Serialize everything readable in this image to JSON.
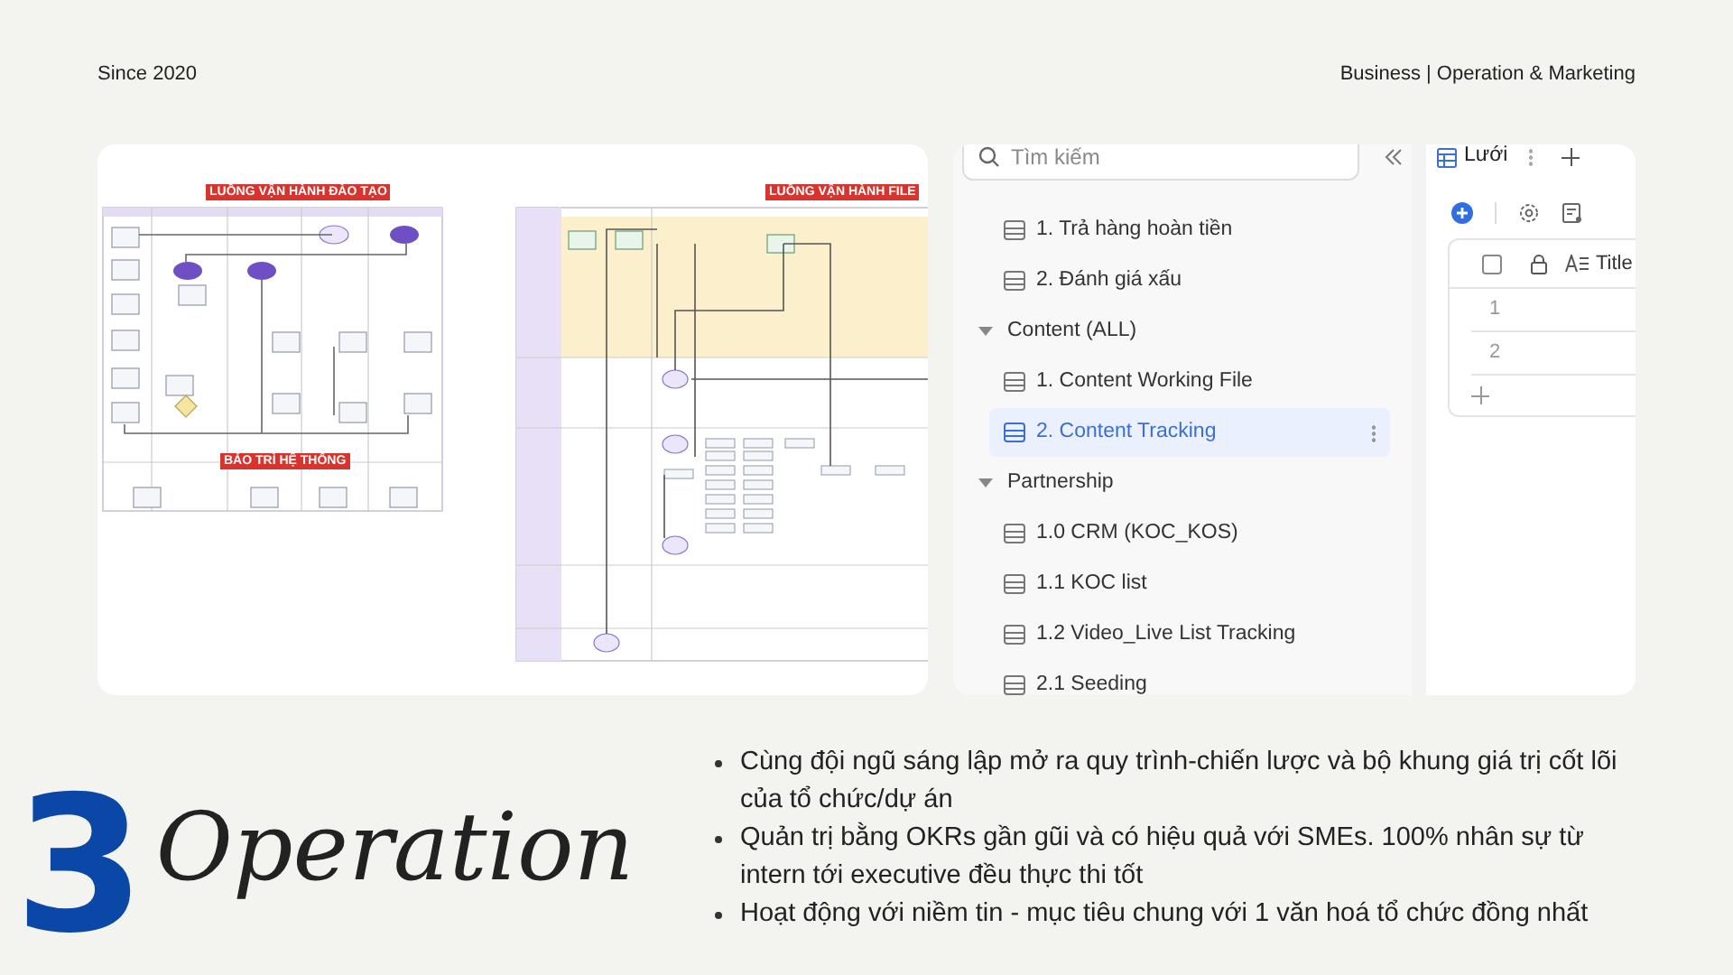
{
  "header": {
    "left": "Since 2020",
    "right": "Business | Operation & Marketing"
  },
  "diagrams": [
    {
      "title": "LUỒNG VẬN HÀNH ĐÀO TẠO",
      "subtitle": "BẢO TRÌ HỆ THỐNG"
    },
    {
      "title": "LUỒNG VẬN HÀNH FILE"
    }
  ],
  "app": {
    "search": {
      "placeholder": "Tìm kiếm"
    },
    "tree": [
      {
        "kind": "table",
        "label": "1. Trả hàng hoàn tiền",
        "selected": false
      },
      {
        "kind": "table",
        "label": "2. Đánh giá xấu",
        "selected": false
      },
      {
        "kind": "folder",
        "label": "Content (ALL)",
        "expanded": true,
        "children": [
          {
            "kind": "table",
            "label": "1. Content Working File",
            "selected": false
          },
          {
            "kind": "table",
            "label": "2. Content Tracking",
            "selected": true
          }
        ]
      },
      {
        "kind": "folder",
        "label": "Partnership",
        "expanded": true,
        "children": [
          {
            "kind": "table",
            "label": "1.0 CRM (KOC_KOS)",
            "selected": false
          },
          {
            "kind": "table",
            "label": "1.1 KOC list",
            "selected": false
          },
          {
            "kind": "table",
            "label": "1.2 Video_Live List Tracking",
            "selected": false
          },
          {
            "kind": "table",
            "label": "2.1 Seeding",
            "selected": false
          }
        ]
      }
    ],
    "view_tabs": [
      {
        "label": "Lưới",
        "selected": true
      }
    ],
    "table": {
      "column": "Title",
      "header_checked": false,
      "rows": [
        "1",
        "2"
      ]
    }
  },
  "title": {
    "number": "3",
    "word": "Operation"
  },
  "bullets": [
    "Cùng đội ngũ sáng lập mở ra quy trình-chiến lược và bộ khung giá trị cốt lõi của tổ chức/dự án",
    "Quản trị bằng OKRs gần gũi và có hiệu quả với SMEs. 100% nhân sự từ intern tới executive đều thực thi tốt",
    "Hoạt động với niềm tin - mục tiêu chung với 1 văn hoá tổ chức đồng nhất"
  ]
}
